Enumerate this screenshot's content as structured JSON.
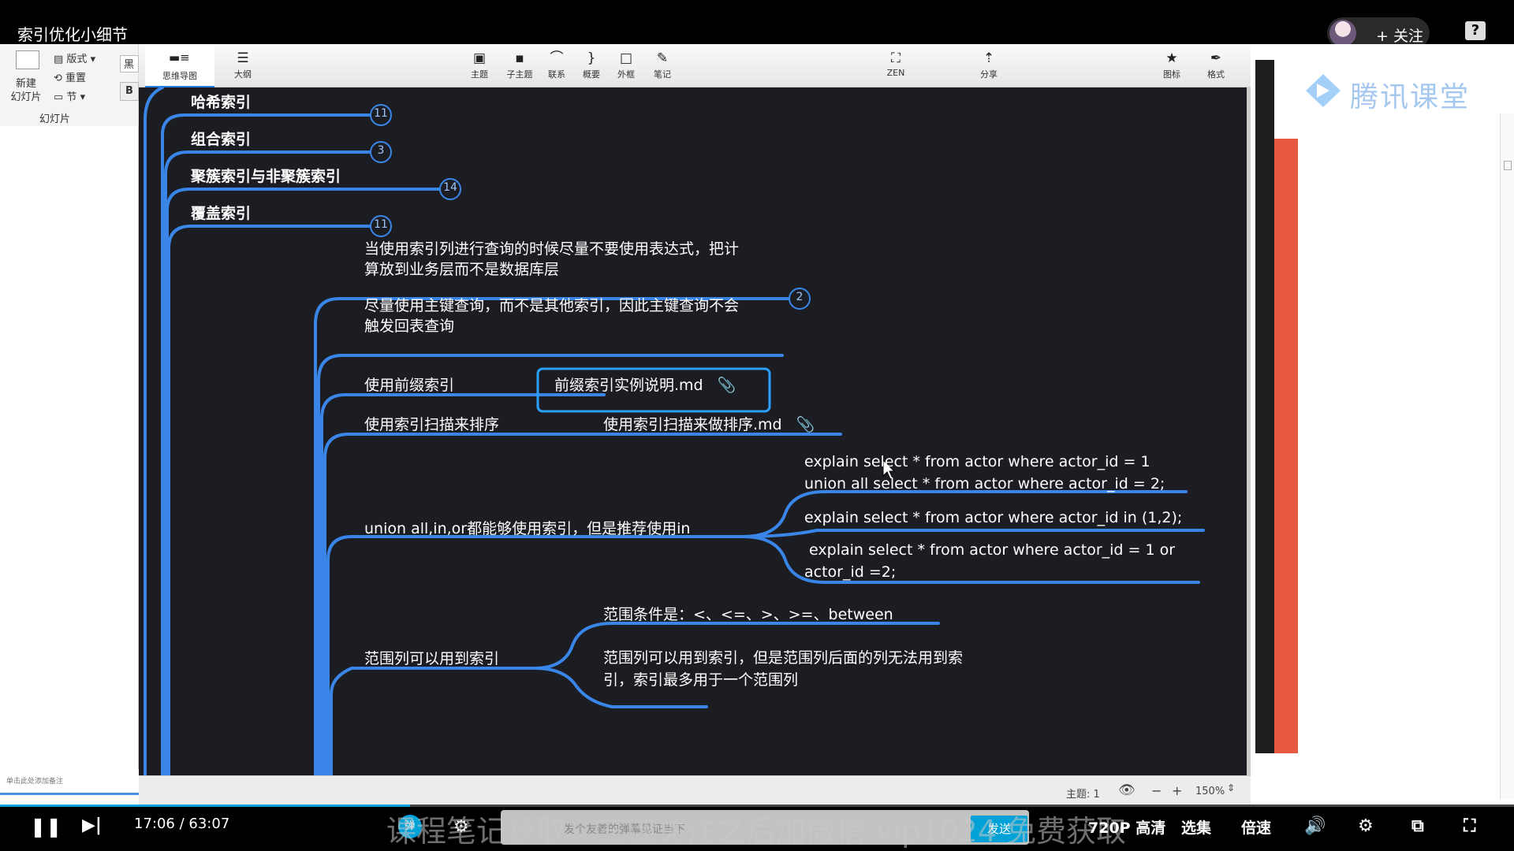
{
  "video": {
    "title": "索引优化小细节",
    "follow_label": "+ 关注",
    "current_time": "17:06",
    "total_time": "63:07",
    "progress_fraction": 0.271,
    "danmaku_toggle": "弹",
    "danmaku_placeholder": "发个友善的弹幕见证当下",
    "send_label": "发送",
    "overlay_text": "课程笔记获取：三连关注之后加微信 vip1024 免费获取",
    "quality_label": "720P 高清",
    "episodes_label": "选集",
    "speed_label": "倍速"
  },
  "ppt": {
    "ribbon": {
      "new_slide": "新建\n幻灯片",
      "layout": "版式",
      "reset": "重置",
      "section": "节",
      "group": "幻灯片",
      "font_hint": "黑",
      "bold": "B"
    },
    "notes_hint": "单击此处添加备注"
  },
  "xmind": {
    "tabs": {
      "mindmap": "思维导图",
      "outline": "大纲"
    },
    "toolbar": [
      {
        "label": "主题",
        "icon": "topic-icon"
      },
      {
        "label": "子主题",
        "icon": "subtopic-icon"
      },
      {
        "label": "联系",
        "icon": "relationship-icon"
      },
      {
        "label": "概要",
        "icon": "summary-icon"
      },
      {
        "label": "外框",
        "icon": "boundary-icon"
      },
      {
        "label": "笔记",
        "icon": "notes-icon"
      },
      {
        "label": "ZEN",
        "icon": "zen-icon"
      },
      {
        "label": "分享",
        "icon": "share-icon"
      },
      {
        "label": "图标",
        "icon": "star-icon"
      },
      {
        "label": "格式",
        "icon": "format-icon"
      }
    ],
    "status": {
      "topic_count": "主题: 1",
      "zoom": "150%"
    },
    "nodes": {
      "hash": "哈希索引",
      "hash_count": "11",
      "composite": "组合索引",
      "composite_count": "3",
      "clustered": "聚簇索引与非聚簇索引",
      "clustered_count": "14",
      "covering": "覆盖索引",
      "covering_count": "11",
      "expr_1": "当使用索引列进行查询的时候尽量不要使用表达式，把计",
      "expr_2": "算放到业务层而不是数据库层",
      "expr_count": "2",
      "pk_1": "尽量使用主键查询，而不是其他索引，因此主键查询不会",
      "pk_2": "触发回表查询",
      "prefix": "使用前缀索引",
      "prefix_attach": "前缀索引实例说明.md",
      "scan": "使用索引扫描来排序",
      "scan_attach": "使用索引扫描来做排序.md",
      "union": "union all,in,or都能够使用索引，但是推荐使用in",
      "union_a1": "explain select * from actor where actor_id = 1",
      "union_a2": "union all select * from actor where actor_id = 2;",
      "union_b": "explain select * from actor where actor_id in (1,2);",
      "union_c1": " explain select * from actor where actor_id = 1 or",
      "union_c2": "actor_id =2;",
      "range": "范围列可以用到索引",
      "range_a": "范围条件是：<、<=、>、>=、between",
      "range_b1": "范围列可以用到索引，但是范围列后面的列无法用到索",
      "range_b2": "引，索引最多用于一个范围列"
    }
  },
  "brand": {
    "name": "腾讯课堂",
    "accent": "#2e86f0",
    "branch_color": "#3a86e8"
  }
}
